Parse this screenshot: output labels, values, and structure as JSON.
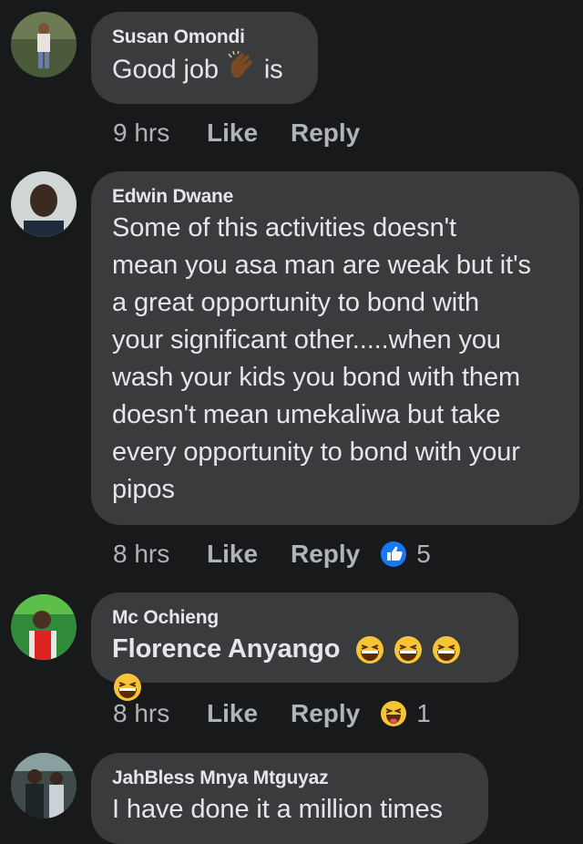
{
  "comments": [
    {
      "author": "Susan Omondi",
      "text_before": "Good job",
      "text_after": "is",
      "inline_emoji": "clapping-hands-emoji",
      "time": "9 hrs",
      "like_label": "Like",
      "reply_label": "Reply"
    },
    {
      "author": "Edwin Dwane",
      "lines": [
        "Some of this activities doesn't",
        "mean you asa man are weak but it's",
        "a great opportunity to bond with",
        "your significant other.....when you",
        "wash your kids you bond with them",
        "doesn't mean umekaliwa but take",
        "every opportunity to bond with your",
        "pipos"
      ],
      "time": "8 hrs",
      "like_label": "Like",
      "reply_label": "Reply",
      "reaction_icon": "like-reaction-icon",
      "reaction_count": "5",
      "reaction_color": "#1877f2"
    },
    {
      "author": "Mc Ochieng",
      "mention": "Florence Anyango",
      "inline_emoji": "grinning-squinting-face-emoji",
      "time": "8 hrs",
      "like_label": "Like",
      "reply_label": "Reply",
      "reaction_icon": "haha-reaction-icon",
      "reaction_count": "1"
    },
    {
      "author": "JahBless Mnya Mtguyaz",
      "text": "I have done it a million times"
    }
  ],
  "colors": {
    "background": "#18191a",
    "bubble": "#3a3b3c",
    "primary_text": "#e4e6eb",
    "secondary_text": "#b0b3b8"
  }
}
